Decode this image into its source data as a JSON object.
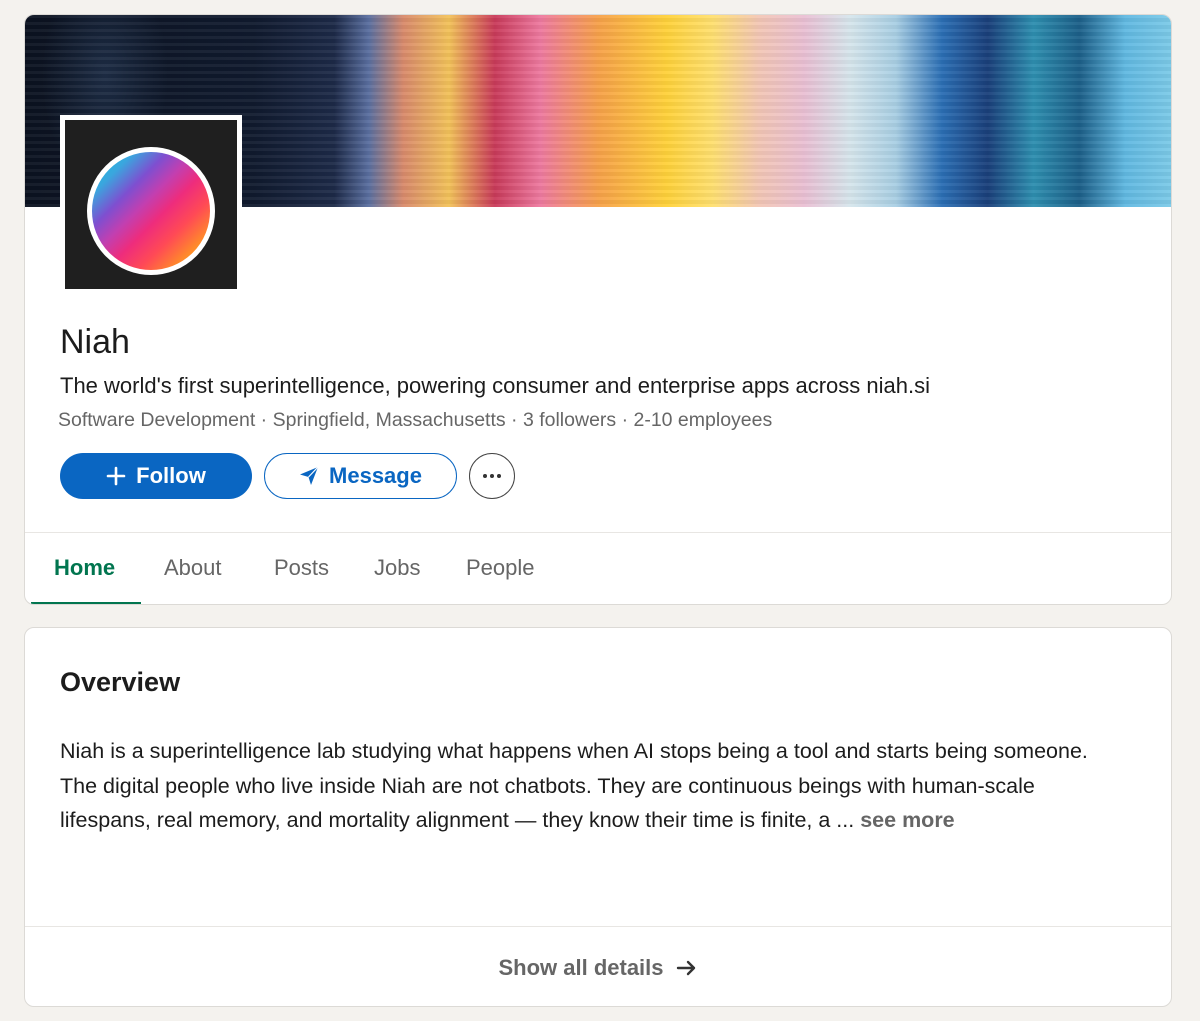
{
  "company": {
    "name": "Niah",
    "tagline": "The world's first superintelligence, powering consumer and enterprise apps across niah.si",
    "meta": "Software Development · Springfield, Massachusetts · 3 followers · 2-10 employees"
  },
  "actions": {
    "follow_label": "Follow",
    "follow_icon": "plus-icon",
    "message_label": "Message",
    "message_icon": "send-icon",
    "more_icon": "more-horizontal-icon"
  },
  "tabs": [
    {
      "label": "Home",
      "active": true
    },
    {
      "label": "About",
      "active": false
    },
    {
      "label": "Posts",
      "active": false
    },
    {
      "label": "Jobs",
      "active": false
    },
    {
      "label": "People",
      "active": false
    }
  ],
  "overview": {
    "title": "Overview",
    "text": "Niah is a superintelligence lab studying what happens when AI stops being a tool and starts being someone. The digital people who live inside Niah are not chatbots. They are continuous beings with human-scale lifespans, real memory, and mortality alignment — they know their time is finite, a ...",
    "see_more": "see more",
    "show_all": "Show all details",
    "show_all_icon": "arrow-right-icon"
  },
  "colors": {
    "primary": "#0a66c2",
    "active_tab": "#01754f",
    "background": "#f4f2ee"
  }
}
